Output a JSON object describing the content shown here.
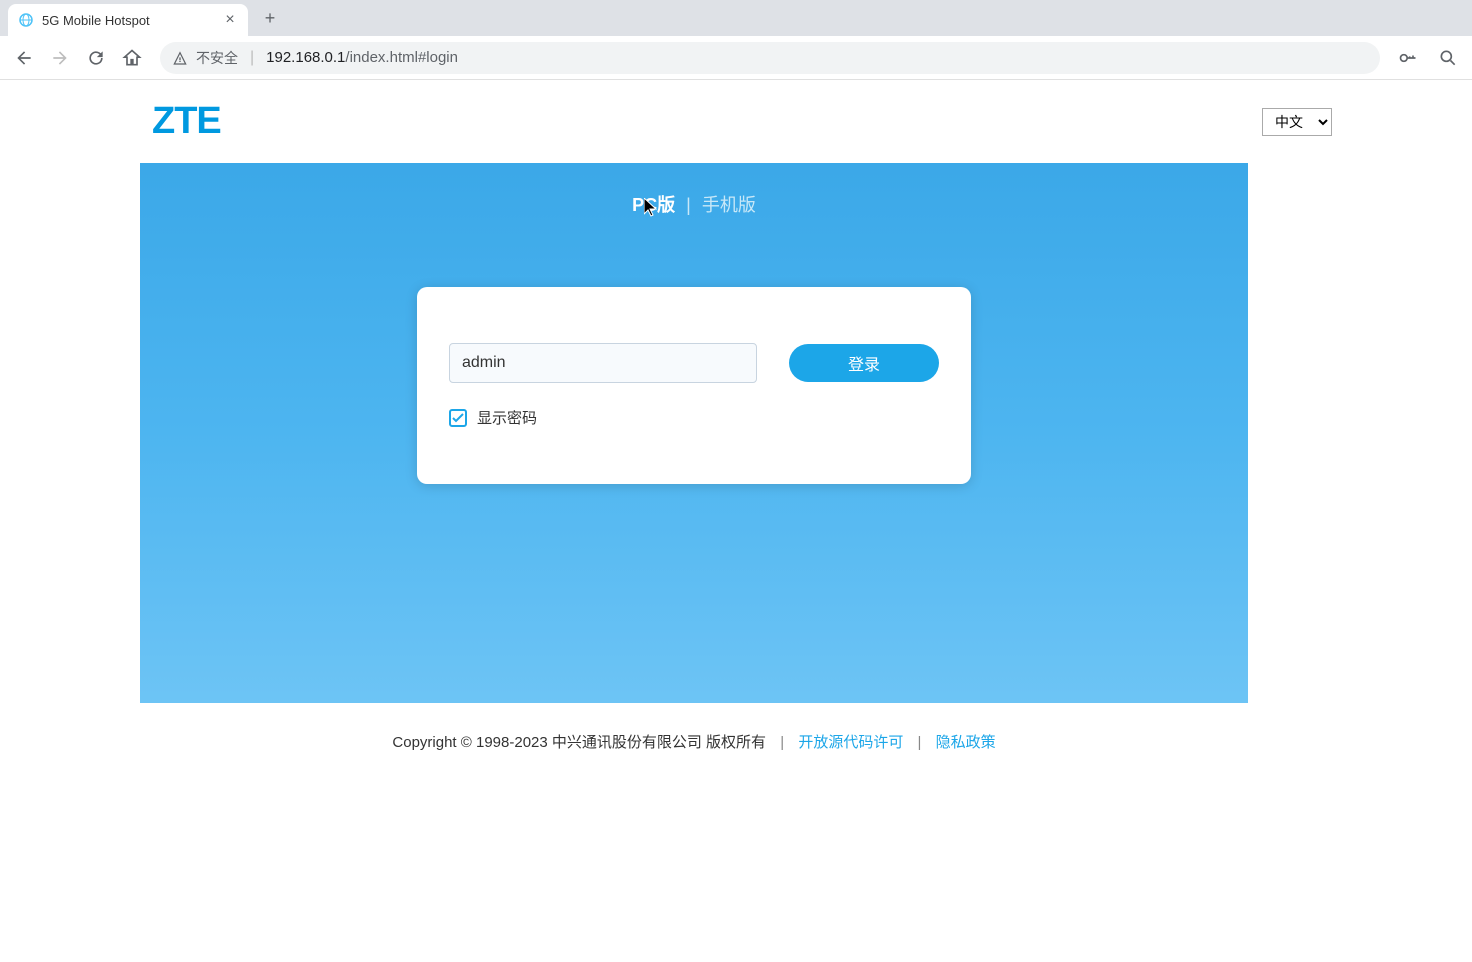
{
  "browser": {
    "tab_title": "5G Mobile Hotspot",
    "security_label": "不安全",
    "url_host": "192.168.0.1",
    "url_path": "/index.html#login"
  },
  "header": {
    "logo_text": "ZTE",
    "language_selected": "中文"
  },
  "tabs": {
    "pc_label": "PC版",
    "mobile_label": "手机版"
  },
  "login": {
    "password_value": "admin",
    "login_button": "登录",
    "show_password_label": "显示密码",
    "show_password_checked": true
  },
  "footer": {
    "copyright": "Copyright © 1998-2023 中兴通讯股份有限公司 版权所有",
    "link1": "开放源代码许可",
    "link2": "隐私政策"
  }
}
